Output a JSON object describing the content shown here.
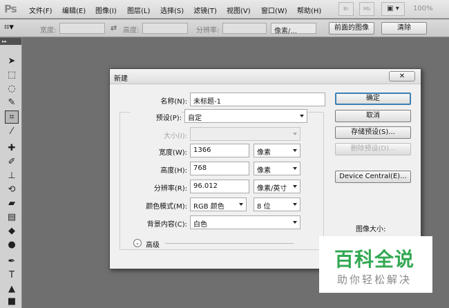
{
  "app": {
    "logo": "Ps"
  },
  "menu": [
    {
      "label": "文件(F)"
    },
    {
      "label": "编辑(E)"
    },
    {
      "label": "图像(I)"
    },
    {
      "label": "图层(L)"
    },
    {
      "label": "选择(S)"
    },
    {
      "label": "滤镜(T)"
    },
    {
      "label": "视图(V)"
    },
    {
      "label": "窗口(W)"
    },
    {
      "label": "帮助(H)"
    }
  ],
  "menubar": {
    "btn_br": "Br",
    "btn_mb": "Mb",
    "zoom": "100%"
  },
  "options": {
    "width_label": "宽度:",
    "height_label": "高度:",
    "resolution_label": "分辨率:",
    "unit": "像素/...",
    "front_image_button": "前面的图像",
    "clear_button": "清除"
  },
  "dialog": {
    "title": "新建",
    "close": "✕",
    "name_label": "名称(N):",
    "name_value": "未标题-1",
    "preset_label": "预设(P):",
    "preset_value": "自定",
    "size_label": "大小(I):",
    "width_label": "宽度(W):",
    "width_value": "1366",
    "width_unit": "像素",
    "height_label": "高度(H):",
    "height_value": "768",
    "height_unit": "像素",
    "resolution_label": "分辨率(R):",
    "resolution_value": "96.012",
    "resolution_unit": "像素/英寸",
    "color_mode_label": "颜色模式(M):",
    "color_mode_value": "RGB 颜色",
    "bit_depth_value": "8 位",
    "background_label": "背景内容(C):",
    "background_value": "白色",
    "advanced_label": "高级",
    "ok_button": "确定",
    "cancel_button": "取消",
    "save_preset_button": "存储预设(S)...",
    "delete_preset_button": "删除预设(D)...",
    "device_central_button": "Device Central(E)...",
    "image_size_label": "图像大小:"
  },
  "watermark": {
    "main": "百科全说",
    "sub": "助你轻松解决"
  },
  "colors": {
    "accent": "#3c7fb1",
    "watermark_green": "#33a853"
  }
}
